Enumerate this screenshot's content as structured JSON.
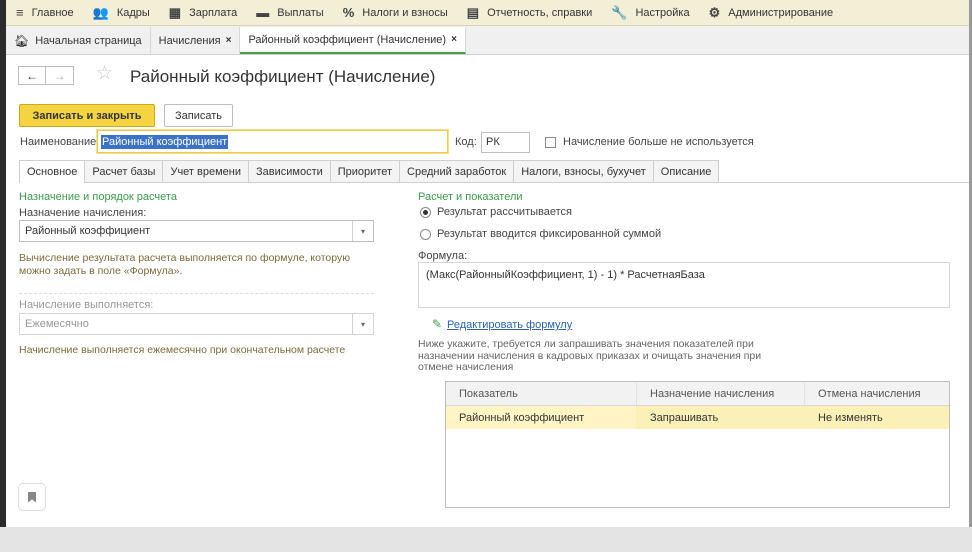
{
  "menu": [
    {
      "icon": "≡",
      "label": "Главное"
    },
    {
      "icon": "👥",
      "label": "Кадры"
    },
    {
      "icon": "▦",
      "label": "Зарплата"
    },
    {
      "icon": "▬",
      "label": "Выплаты"
    },
    {
      "icon": "%",
      "label": "Налоги и взносы"
    },
    {
      "icon": "▤",
      "label": "Отчетность, справки"
    },
    {
      "icon": "🔧",
      "label": "Настройка"
    },
    {
      "icon": "⚙",
      "label": "Администрирование"
    }
  ],
  "tabs": {
    "home": "Начальная страница",
    "accruals": "Начисления",
    "active": "Районный коэффициент (Начисление)",
    "close": "×"
  },
  "nav": {
    "back": "←",
    "forward": "→",
    "star": "☆"
  },
  "title": "Районный коэффициент (Начисление)",
  "toolbar": {
    "save_close": "Записать и закрыть",
    "save": "Записать"
  },
  "form": {
    "name_label": "Наименование:",
    "name_value": "Районный коэффициент",
    "code_label": "Код:",
    "code_value": "РК",
    "unused_label": "Начисление больше не используется"
  },
  "form_tabs": [
    "Основное",
    "Расчет базы",
    "Учет времени",
    "Зависимости",
    "Приоритет",
    "Средний заработок",
    "Налоги, взносы, бухучет",
    "Описание"
  ],
  "left": {
    "section_title": "Назначение и порядок расчета",
    "purpose_label": "Назначение начисления:",
    "purpose_value": "Районный коэффициент",
    "purpose_note": "Вычисление результата расчета выполняется по формуле, которую можно задать в поле «Формула».",
    "performed_label": "Начисление выполняется:",
    "performed_value": "Ежемесячно",
    "performed_note": "Начисление выполняется ежемесячно при окончательном расчете"
  },
  "right": {
    "section_title": "Расчет и показатели",
    "radio_calc": "Результат рассчитывается",
    "radio_fixed": "Результат вводится фиксированной суммой",
    "formula_label": "Формула:",
    "formula_value": "(Макс(РайонныйКоэффициент, 1) - 1) * РасчетнаяБаза",
    "edit_formula": "Редактировать формулу",
    "info_text": "Ниже укажите, требуется ли запрашивать значения показателей при назначении начисления в кадровых приказах и очищать значения при отмене начисления",
    "table": {
      "headers": [
        "Показатель",
        "Назначение начисления",
        "Отмена начисления"
      ],
      "rows": [
        [
          "Районный коэффициент",
          "Запрашивать",
          "Не изменять"
        ]
      ]
    }
  },
  "colors": {
    "accent_yellow": "#f5d442",
    "green": "#3b9a49",
    "menu_bg": "#f3efd7",
    "link": "#2a62b8"
  }
}
